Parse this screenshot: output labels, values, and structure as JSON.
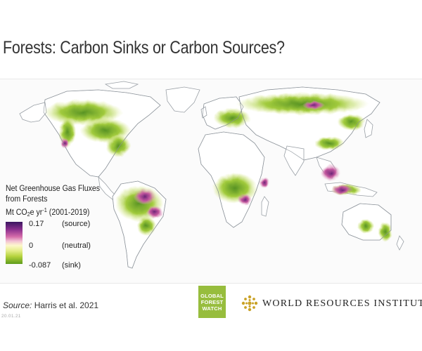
{
  "title": "Forests: Carbon Sinks or Carbon Sources?",
  "map": {
    "subject": "world",
    "theme": "Net greenhouse gas fluxes from forests",
    "colors": {
      "source_max": "#3a1660",
      "source_mid": "#c65aa0",
      "neutral": "#fdf8cc",
      "sink_mid": "#b5d33d",
      "sink_max": "#4f8d18",
      "land": "#ffffff",
      "coast": "#9aa0a6"
    }
  },
  "legend": {
    "title_line1": "Net Greenhouse Gas Fluxes",
    "title_line2": "from Forests",
    "units_prefix": "Mt CO",
    "units_sub": "2",
    "units_mid": "e yr",
    "units_sup": "-1",
    "units_period": " (2001-2019)",
    "ticks": [
      {
        "value": "0.17",
        "label": "(source)"
      },
      {
        "value": "0",
        "label": "(neutral)"
      },
      {
        "value": "-0.087",
        "label": "(sink)"
      }
    ]
  },
  "source": {
    "label": "Source:",
    "text": "Harris et al. 2021"
  },
  "stamp": "20.01.21",
  "logos": {
    "gfw": [
      "GLOBAL",
      "FOREST",
      "WATCH"
    ],
    "wri": "WORLD RESOURCES INSTITUTE",
    "gfw_color": "#97bd3d",
    "wri_color": "#c9a227"
  }
}
